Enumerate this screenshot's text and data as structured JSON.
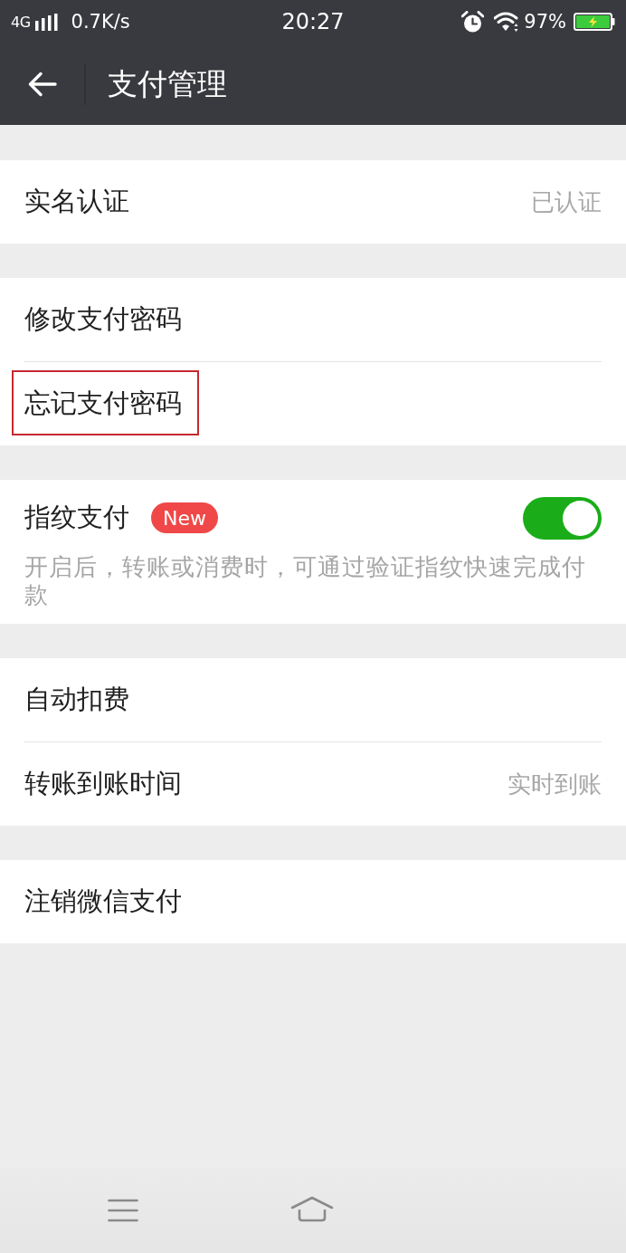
{
  "status_bar": {
    "network": "4G",
    "speed": "0.7K/s",
    "time": "20:27",
    "battery": "97%",
    "charging": true
  },
  "header": {
    "title": "支付管理"
  },
  "groups": [
    {
      "items": [
        {
          "kind": "link",
          "label": "实名认证",
          "value": "已认证",
          "highlighted": false
        }
      ]
    },
    {
      "items": [
        {
          "kind": "link",
          "label": "修改支付密码",
          "highlighted": false
        },
        {
          "kind": "link",
          "label": "忘记支付密码",
          "highlighted": true
        }
      ]
    },
    {
      "items": [
        {
          "kind": "toggle",
          "label": "指纹支付",
          "badge": "New",
          "on": true,
          "description": "开启后，转账或消费时，可通过验证指纹快速完成付款",
          "highlighted": false
        }
      ]
    },
    {
      "items": [
        {
          "kind": "link",
          "label": "自动扣费",
          "highlighted": false
        },
        {
          "kind": "link",
          "label": "转账到账时间",
          "value": "实时到账",
          "highlighted": false
        }
      ]
    },
    {
      "items": [
        {
          "kind": "link",
          "label": "注销微信支付",
          "highlighted": false
        }
      ]
    }
  ]
}
